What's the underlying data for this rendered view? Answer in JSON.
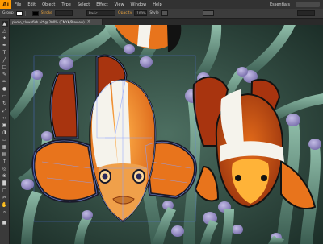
{
  "app": {
    "logo": "Ai"
  },
  "menu": [
    "File",
    "Edit",
    "Object",
    "Type",
    "Select",
    "Effect",
    "View",
    "Window",
    "Help"
  ],
  "workspace": {
    "label": "Essentials",
    "search_placeholder": ""
  },
  "controlbar": {
    "selection_label": "Group",
    "stroke_label": "Stroke",
    "brush_value": "Basic",
    "opacity_label": "Opacity",
    "opacity_value": "100%",
    "style_label": "Style",
    "transform_value": "",
    "fill_color": "#ffffff",
    "stroke_color": "#000000"
  },
  "document": {
    "tab_title": "photo_clownfish.ai* @ 200% (CMYK/Preview)"
  },
  "tools": [
    "selection-tool",
    "direct-selection-tool",
    "magic-wand-tool",
    "lasso-tool",
    "pen-tool",
    "type-tool",
    "line-tool",
    "rectangle-tool",
    "paintbrush-tool",
    "pencil-tool",
    "blob-brush-tool",
    "eraser-tool",
    "rotate-tool",
    "scale-tool",
    "width-tool",
    "free-transform-tool",
    "shape-builder-tool",
    "perspective-grid-tool",
    "mesh-tool",
    "gradient-tool",
    "eyedropper-tool",
    "blend-tool",
    "symbol-sprayer-tool",
    "column-graph-tool",
    "artboard-tool",
    "slice-tool",
    "hand-tool",
    "zoom-tool"
  ],
  "colors": {
    "accent": "#ff9a00",
    "fish_orange": "#e8741c",
    "fish_white": "#f5f3ec",
    "fish_black": "#121212",
    "anemone": "#6f9e88",
    "anemone_tip": "#9c93c9",
    "path_overlay": "#8aa0ff"
  }
}
